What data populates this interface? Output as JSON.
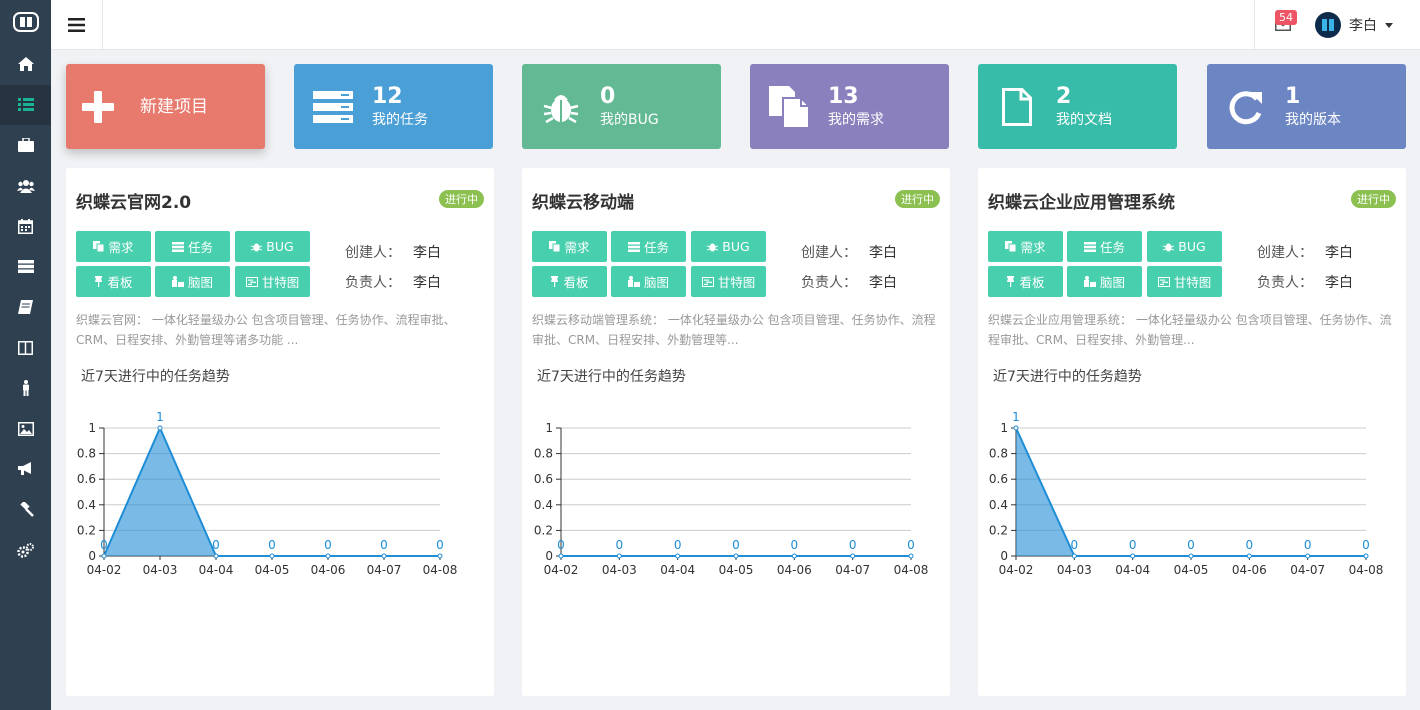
{
  "topbar": {
    "menu_icon": "hamburger-icon",
    "msg_count": "54",
    "user_name": "李白"
  },
  "sidebar": {
    "items": [
      "home-icon",
      "list-icon",
      "briefcase-icon",
      "users-icon",
      "calendar-icon",
      "server-icon",
      "book-icon",
      "columns-icon",
      "person-icon",
      "image-icon",
      "bullhorn-icon",
      "gavel-icon",
      "cogs-icon"
    ],
    "active_index": 1
  },
  "stats": [
    {
      "label": "新建项目",
      "color": "#e8796d"
    },
    {
      "num": "12",
      "label": "我的任务",
      "color": "#4a9fd7"
    },
    {
      "num": "0",
      "label": "我的BUG",
      "color": "#62b994"
    },
    {
      "num": "13",
      "label": "我的需求",
      "color": "#8a80bd"
    },
    {
      "num": "2",
      "label": "我的文档",
      "color": "#37bcaa"
    },
    {
      "num": "1",
      "label": "我的版本",
      "color": "#6c86c4"
    }
  ],
  "projects": [
    {
      "name": "织蝶云官网2.0",
      "status": "进行中",
      "creator_label": "创建人：",
      "creator": "李白",
      "owner_label": "负责人：",
      "owner": "李白",
      "desc": "织蝶云官网： 一体化轻量级办公 包含项目管理、任务协作、流程审批、CRM、日程安排、外勤管理等诸多功能 ...",
      "chart_title": "近7天进行中的任务趋势"
    },
    {
      "name": "织蝶云移动端",
      "status": "进行中",
      "creator_label": "创建人：",
      "creator": "李白",
      "owner_label": "负责人：",
      "owner": "李白",
      "desc": "织蝶云移动端管理系统： 一体化轻量级办公 包含项目管理、任务协作、流程审批、CRM、日程安排、外勤管理等...",
      "chart_title": "近7天进行中的任务趋势"
    },
    {
      "name": "织蝶云企业应用管理系统",
      "status": "进行中",
      "creator_label": "创建人：",
      "creator": "李白",
      "owner_label": "负责人：",
      "owner": "李白",
      "desc": "织蝶云企业应用管理系统： 一体化轻量级办公 包含项目管理、任务协作、流程审批、CRM、日程安排、外勤管理...",
      "chart_title": "近7天进行中的任务趋势"
    }
  ],
  "buttons": [
    "需求",
    "任务",
    "BUG",
    "看板",
    "脑图",
    "甘特图"
  ],
  "chart_data": [
    {
      "type": "area",
      "x": [
        "04-02",
        "04-03",
        "04-04",
        "04-05",
        "04-06",
        "04-07",
        "04-08"
      ],
      "values": [
        0,
        1,
        0,
        0,
        0,
        0,
        0
      ],
      "ylim": [
        0,
        1
      ],
      "yticks": [
        "0",
        "0.2",
        "0.4",
        "0.6",
        "0.8",
        "1"
      ],
      "color": "#1f8dd6"
    },
    {
      "type": "area",
      "x": [
        "04-02",
        "04-03",
        "04-04",
        "04-05",
        "04-06",
        "04-07",
        "04-08"
      ],
      "values": [
        0,
        0,
        0,
        0,
        0,
        0,
        0
      ],
      "ylim": [
        0,
        1
      ],
      "yticks": [
        "0",
        "0.2",
        "0.4",
        "0.6",
        "0.8",
        "1"
      ],
      "color": "#1f8dd6"
    },
    {
      "type": "area",
      "x": [
        "04-02",
        "04-03",
        "04-04",
        "04-05",
        "04-06",
        "04-07",
        "04-08"
      ],
      "values": [
        1,
        0,
        0,
        0,
        0,
        0,
        0
      ],
      "ylim": [
        0,
        1
      ],
      "yticks": [
        "0",
        "0.2",
        "0.4",
        "0.6",
        "0.8",
        "1"
      ],
      "color": "#1f8dd6"
    }
  ]
}
